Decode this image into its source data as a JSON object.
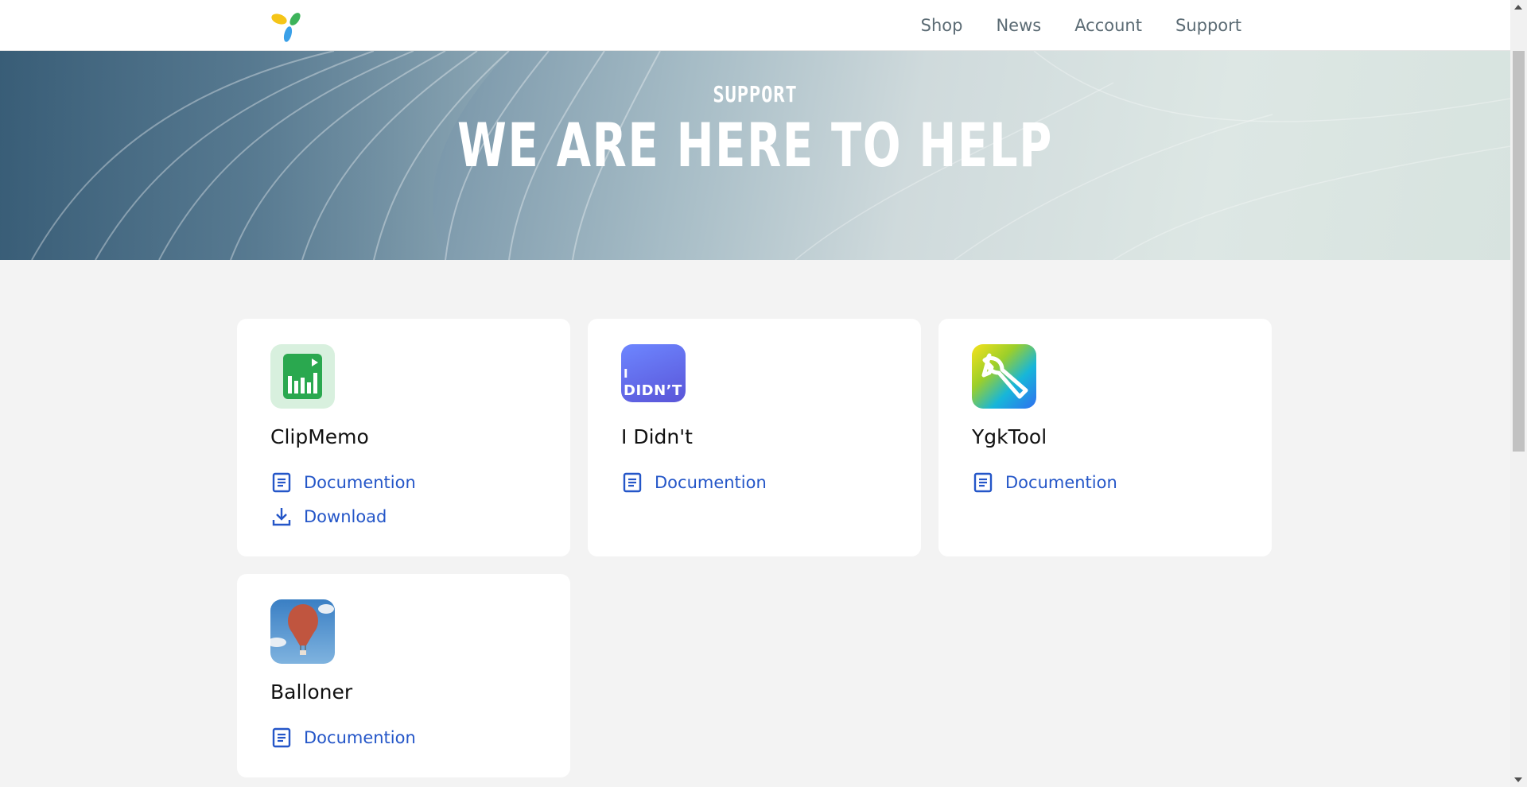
{
  "nav": {
    "logo_icon": "tri-leaf-logo-icon",
    "items": [
      "Shop",
      "News",
      "Account",
      "Support"
    ]
  },
  "hero": {
    "subtitle": "SUPPORT",
    "title": "WE ARE HERE TO HELP"
  },
  "products": [
    {
      "name": "ClipMemo",
      "icon": "clipmemo-app-icon",
      "links": [
        {
          "label": "Documention",
          "icon": "document-icon"
        },
        {
          "label": "Download",
          "icon": "download-icon"
        }
      ]
    },
    {
      "name": "I Didn't",
      "icon": "i-didnt-app-icon",
      "icon_text_1": "I",
      "icon_text_2": "DIDN’T",
      "links": [
        {
          "label": "Documention",
          "icon": "document-icon"
        }
      ]
    },
    {
      "name": "YgkTool",
      "icon": "wrench-app-icon",
      "links": [
        {
          "label": "Documention",
          "icon": "document-icon"
        }
      ]
    },
    {
      "name": "Balloner",
      "icon": "balloon-app-icon",
      "links": [
        {
          "label": "Documention",
          "icon": "document-icon"
        }
      ]
    }
  ],
  "colors": {
    "link": "#2456c8",
    "nav_text": "#5b6b74",
    "page_bg": "#f3f3f3"
  }
}
